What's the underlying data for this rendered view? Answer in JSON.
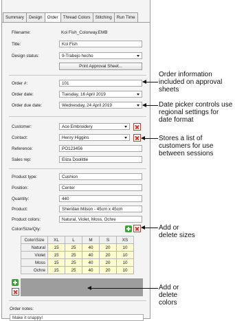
{
  "tabs": [
    "Summary",
    "Design",
    "Order",
    "Thread Colors",
    "Stitching",
    "Run Time"
  ],
  "active_tab": "Order",
  "design": {
    "filename_label": "Filename:",
    "filename": "Koi Fish_Colorway.EMB",
    "title_label": "Title:",
    "title": "Koi Fish",
    "status_label": "Design status:",
    "status": "9-Trabejo hecho",
    "print_button": "Print Approval Sheet..."
  },
  "order": {
    "number_label": "Order #:",
    "number": "101",
    "date_label": "Order date:",
    "date": "Tuesday, 16 April 2019",
    "due_label": "Order due date:",
    "due": "Wednesday, 24 April 2019"
  },
  "customer": {
    "customer_label": "Customer:",
    "customer": "Ace Embroidery",
    "contact_label": "Contact:",
    "contact": "Henry Higgins",
    "reference_label": "Reference:",
    "reference": "PO123456",
    "salesrep_label": "Sales rep:",
    "salesrep": "Eliza Doolittle"
  },
  "product": {
    "type_label": "Product type:",
    "type": "Cushion",
    "position_label": "Position:",
    "position": "Center",
    "quantity_label": "Quantity:",
    "quantity": "440",
    "product_label": "Product:",
    "product": "Sheridan Milson - 45cm x 45cm",
    "colors_label": "Product colors:",
    "colors": "Natural, Violet, Moss, Ochre",
    "csq_label": "Color/Size/Qty:"
  },
  "grid": {
    "corner": "Color\\Size",
    "sizes": [
      "XL",
      "L",
      "M",
      "S",
      "XS"
    ],
    "rows": [
      {
        "color": "Natural",
        "values": [
          "15",
          "25",
          "40",
          "20",
          "10"
        ]
      },
      {
        "color": "Violet",
        "values": [
          "15",
          "25",
          "40",
          "20",
          "10"
        ]
      },
      {
        "color": "Moss",
        "values": [
          "15",
          "25",
          "40",
          "20",
          "10"
        ]
      },
      {
        "color": "Ochre",
        "values": [
          "15",
          "25",
          "40",
          "20",
          "10"
        ]
      }
    ]
  },
  "notes": {
    "label": "Order notes:",
    "text": "Make it snappy!"
  },
  "callouts": {
    "order_info": "Order information included on approval sheets",
    "date_picker": "Date picker controls use regional settings for date format",
    "customers": "Stores a list of customers for use between sessions",
    "sizes": "Add or delete sizes",
    "colors": "Add or delete colors"
  },
  "colors": {
    "add": "#3aa335",
    "delete": "#d2362a",
    "qty_cell": "#fdfbd0",
    "grey_area": "#9d9d9d"
  }
}
